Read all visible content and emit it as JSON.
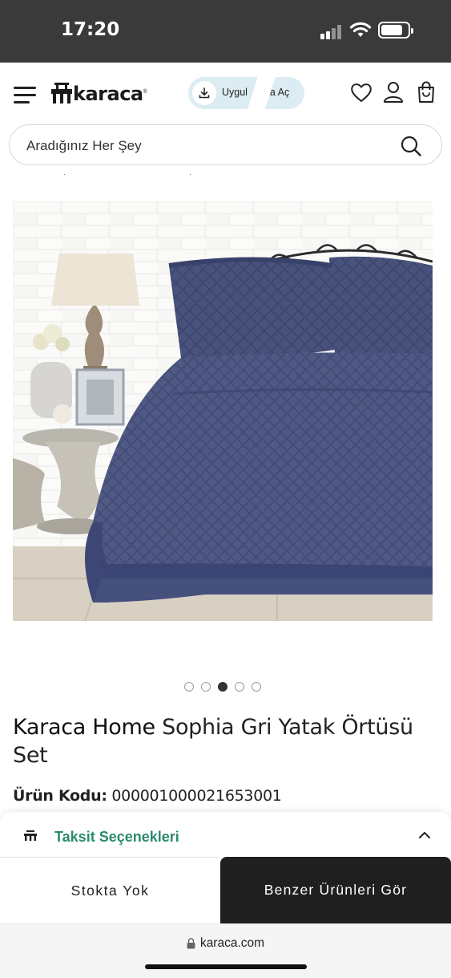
{
  "status_bar": {
    "time": "17:20",
    "icons": [
      "cellular-signal-icon",
      "wifi-icon",
      "battery-icon"
    ]
  },
  "header": {
    "logo_text": "karaca",
    "logo_reg": "®",
    "app_banner": {
      "text_left": "Uygul",
      "text_right": "da Aç",
      "icon": "download-icon"
    },
    "icons": [
      "menu-icon",
      "heart-icon",
      "user-icon",
      "shopping-bag-icon"
    ]
  },
  "search": {
    "placeholder": "Aradığınız Her Şey",
    "icon": "search-icon"
  },
  "gallery": {
    "image_name": "product-image",
    "dot_count": 5,
    "active_index": 2
  },
  "product": {
    "brand": "Karaca Home",
    "name": " Sophia Gri Yatak Örtüsü Set",
    "code_label": "Ürün Kodu:",
    "code_value": " 000001000021653001"
  },
  "installments": {
    "label": "Taksit Seçenekleri",
    "icon": "chevron-up-icon"
  },
  "actions": {
    "out_of_stock": "Stokta Yok",
    "similar": "Benzer Ürünleri Gör"
  },
  "browser": {
    "url": "karaca.com",
    "icon": "lock-icon"
  },
  "colors": {
    "accent_green": "#2a8a6e",
    "dark_button": "#1f1f1f",
    "pill_bg": "#dcecf3",
    "status_bar": "#3a3a3a"
  }
}
